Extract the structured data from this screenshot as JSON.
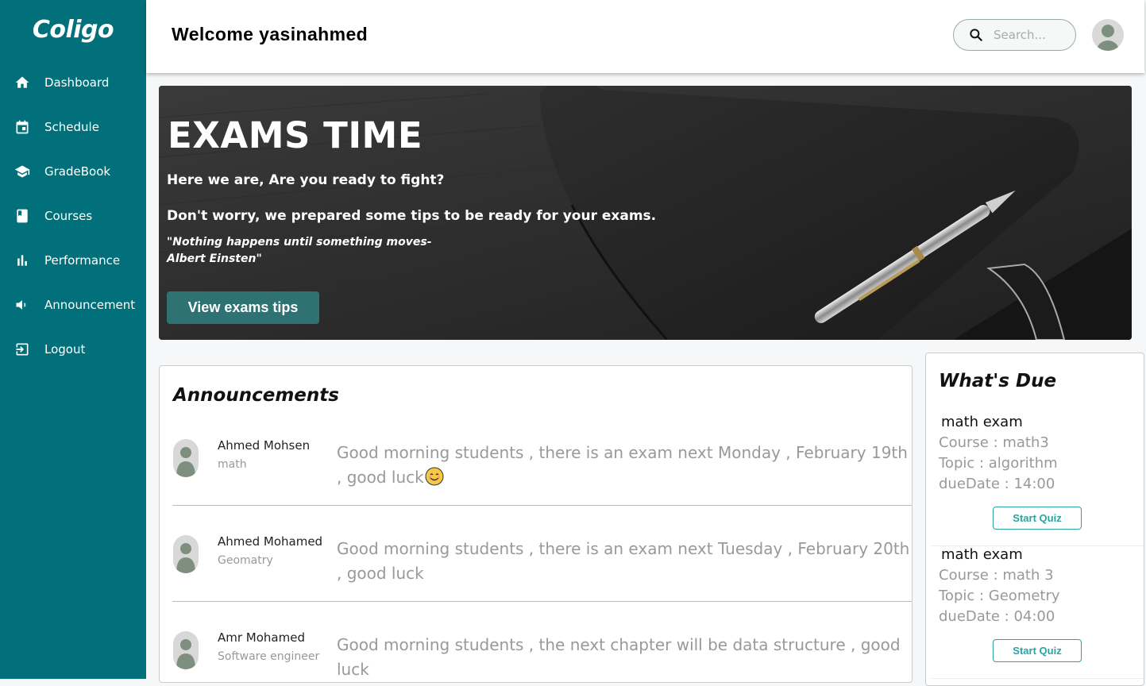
{
  "app": {
    "logo": "Coligo"
  },
  "sidebar": {
    "items": [
      {
        "label": "Dashboard",
        "icon": "home-icon"
      },
      {
        "label": "Schedule",
        "icon": "calendar-icon"
      },
      {
        "label": "GradeBook",
        "icon": "graduation-cap-icon"
      },
      {
        "label": "Courses",
        "icon": "book-icon"
      },
      {
        "label": "Performance",
        "icon": "bar-chart-icon"
      },
      {
        "label": "Announcement",
        "icon": "megaphone-icon"
      },
      {
        "label": "Logout",
        "icon": "logout-icon"
      }
    ]
  },
  "header": {
    "welcome": "Welcome yasinahmed",
    "search_placeholder": "Search..."
  },
  "hero": {
    "title": "EXAMS TIME",
    "line1": "Here we are, Are you ready to fight?",
    "line2": "Don't worry, we prepared some tips to be ready for your exams.",
    "quote": "\"Nothing happens until something moves- Albert Einsten\"",
    "button": "View exams tips"
  },
  "announcements": {
    "title": "Announcements",
    "items": [
      {
        "name": "Ahmed Mohsen",
        "subject": "math",
        "message": "Good morning students , there is an exam next Monday , February 19th , good luck"
      },
      {
        "name": "Ahmed Mohamed",
        "subject": "Geomatry",
        "message": "Good morning students , there is an exam next Tuesday , February 20th , good luck"
      },
      {
        "name": "Amr Mohamed",
        "subject": "Software engineer",
        "message": "Good morning students , the next chapter will be data structure , good luck"
      }
    ]
  },
  "due": {
    "title": "What's Due",
    "items": [
      {
        "name": "math exam",
        "course": "Course : math3",
        "topic": "Topic : algorithm",
        "date": "dueDate : 14:00",
        "button": "Start Quiz"
      },
      {
        "name": "math exam",
        "course": "Course : math 3",
        "topic": "Topic : Geometry",
        "date": "dueDate : 04:00",
        "button": "Start Quiz"
      }
    ]
  },
  "colors": {
    "sidebar": "#01707b",
    "hero_button": "#2e7273",
    "quiz_button": "#2aa3a0"
  }
}
